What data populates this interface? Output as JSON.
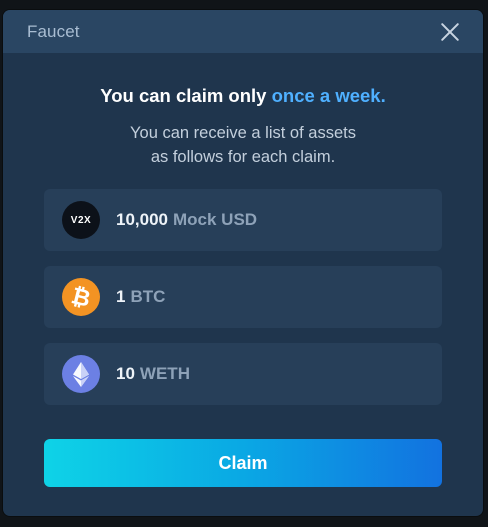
{
  "dialog": {
    "title": "Faucet",
    "close_icon": "close-icon"
  },
  "headline": {
    "prefix": "You can claim only ",
    "accent": "once a week."
  },
  "subtitle": {
    "line1": "You can receive a list of assets",
    "line2": "as follows for each claim."
  },
  "assets": [
    {
      "icon": "v2x-logo-icon",
      "icon_text": "V2X",
      "amount": "10,000",
      "unit": "Mock USD"
    },
    {
      "icon": "bitcoin-icon",
      "amount": "1",
      "unit": "BTC"
    },
    {
      "icon": "ethereum-icon",
      "amount": "10",
      "unit": "WETH"
    }
  ],
  "claim_button": {
    "label": "Claim"
  },
  "colors": {
    "accent": "#4fb0ff",
    "background": "#1f354d",
    "header": "#2a4663",
    "button_start": "#0ed3e7",
    "button_end": "#1272e0"
  }
}
